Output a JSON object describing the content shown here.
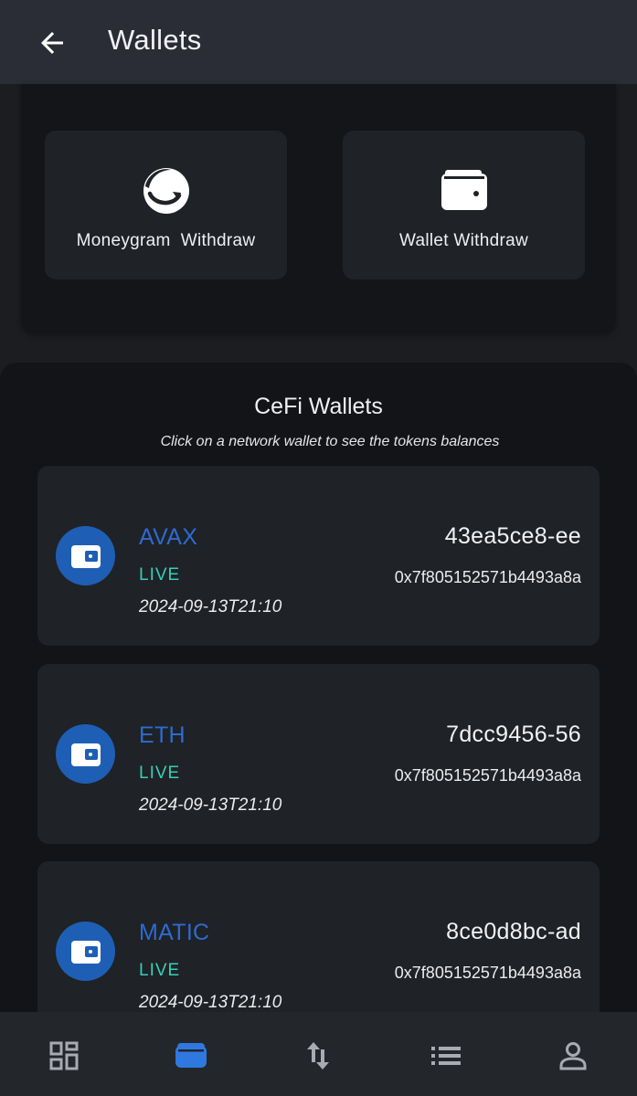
{
  "header": {
    "title": "Wallets",
    "back_icon": "arrow-left-icon"
  },
  "actions": [
    {
      "label": "Moneygram  Withdraw",
      "icon": "moneygram-icon"
    },
    {
      "label": "Wallet Withdraw",
      "icon": "wallet-icon"
    }
  ],
  "cefi": {
    "title": "CeFi Wallets",
    "subtitle": "Click on a network wallet to see the tokens balances",
    "wallets": [
      {
        "network": "AVAX",
        "status": "LIVE",
        "date": "2024-09-13T21:10",
        "id": "43ea5ce8-ee",
        "address": "0x7f805152571b4493a8a"
      },
      {
        "network": "ETH",
        "status": "LIVE",
        "date": "2024-09-13T21:10",
        "id": "7dcc9456-56",
        "address": "0x7f805152571b4493a8a"
      },
      {
        "network": "MATIC",
        "status": "LIVE",
        "date": "2024-09-13T21:10",
        "id": "8ce0d8bc-ad",
        "address": "0x7f805152571b4493a8a"
      }
    ]
  },
  "bottom_nav": {
    "items": [
      {
        "icon": "dashboard-icon",
        "active": false
      },
      {
        "icon": "wallet-icon",
        "active": true
      },
      {
        "icon": "transfer-arrows-icon",
        "active": false
      },
      {
        "icon": "list-icon",
        "active": false
      },
      {
        "icon": "profile-icon",
        "active": false
      }
    ]
  },
  "colors": {
    "accent": "#1e5fb5",
    "network_text": "#2d6bd1",
    "status_live": "#35d0b8",
    "header_bg": "#2a2d35",
    "card_bg": "#1f2226"
  }
}
